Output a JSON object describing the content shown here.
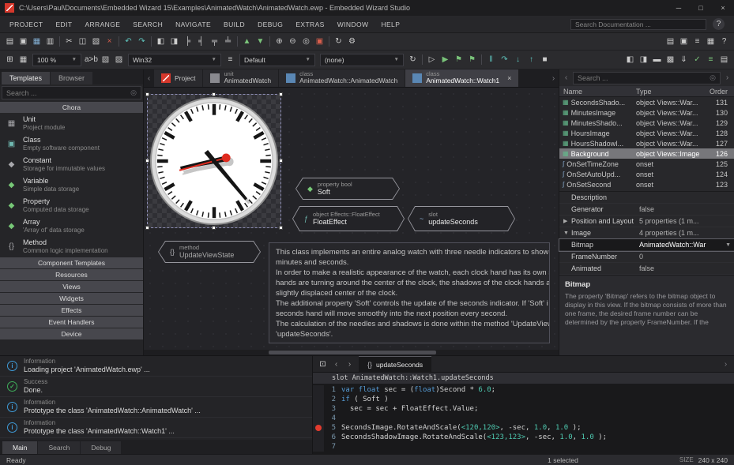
{
  "colors": {
    "accent_red": "#d6382c",
    "selection_gray": "#77777b",
    "keyword_blue": "#569cd6",
    "number_teal": "#4ec9b0",
    "breakpoint_red": "#e23b2e",
    "info_blue": "#3f9bd8",
    "success_green": "#3fae5a"
  },
  "titlebar": {
    "title": "C:\\Users\\Paul\\Documents\\Embedded Wizard 15\\Examples\\AnimatedWatch\\AnimatedWatch.ewp - Embedded Wizard Studio",
    "minimize": "─",
    "maximize": "□",
    "close": "×"
  },
  "menubar": {
    "items": [
      "PROJECT",
      "EDIT",
      "ARRANGE",
      "SEARCH",
      "NAVIGATE",
      "BUILD",
      "DEBUG",
      "EXTRAS",
      "WINDOW",
      "HELP"
    ],
    "doc_search_placeholder": "Search Documentation ...",
    "help_button": "?"
  },
  "toolbar_main": {
    "icons": [
      {
        "name": "new-project",
        "glyph": "▤",
        "color": "#cdcdcd"
      },
      {
        "name": "open-project",
        "glyph": "▣",
        "color": "#cdcdcd"
      },
      {
        "name": "save-all",
        "glyph": "▦",
        "color": "#82aed2"
      },
      {
        "name": "export",
        "glyph": "▥",
        "color": "#cdcdcd"
      },
      {
        "sep": true
      },
      {
        "name": "cut",
        "glyph": "✂",
        "color": "#cdcdcd"
      },
      {
        "name": "copy",
        "glyph": "◫",
        "color": "#cdcdcd"
      },
      {
        "name": "paste",
        "glyph": "▧",
        "color": "#cdcdcd"
      },
      {
        "name": "delete",
        "glyph": "×",
        "color": "#d95f4d"
      },
      {
        "sep": true
      },
      {
        "name": "undo",
        "glyph": "↶",
        "color": "#5fc4bd"
      },
      {
        "name": "redo",
        "glyph": "↷",
        "color": "#5fc4bd"
      },
      {
        "sep": true
      },
      {
        "name": "bring-forward",
        "glyph": "◧",
        "color": "#cdcdcd"
      },
      {
        "name": "send-backward",
        "glyph": "◨",
        "color": "#cdcdcd"
      },
      {
        "name": "align-left",
        "glyph": "╞",
        "color": "#cdcdcd"
      },
      {
        "name": "align-right",
        "glyph": "╡",
        "color": "#cdcdcd"
      },
      {
        "name": "align-top",
        "glyph": "╤",
        "color": "#cdcdcd"
      },
      {
        "name": "align-bottom",
        "glyph": "╧",
        "color": "#cdcdcd"
      },
      {
        "sep": true
      },
      {
        "name": "arrange-up",
        "glyph": "▲",
        "color": "#79c279"
      },
      {
        "name": "arrange-down",
        "glyph": "▼",
        "color": "#79c279"
      },
      {
        "sep": true
      },
      {
        "name": "zoom-in",
        "glyph": "⊕",
        "color": "#cdcdcd"
      },
      {
        "name": "zoom-out",
        "glyph": "⊖",
        "color": "#cdcdcd"
      },
      {
        "name": "zoom-selection",
        "glyph": "◎",
        "color": "#cdcdcd"
      },
      {
        "name": "highlight-unused",
        "glyph": "▣",
        "color": "#d95f4d"
      },
      {
        "sep": true
      },
      {
        "name": "update-screen",
        "glyph": "↻",
        "color": "#cdcdcd"
      },
      {
        "name": "settings-gear",
        "glyph": "⚙",
        "color": "#cdcdcd"
      }
    ],
    "icons_end": [
      {
        "name": "show-gallery",
        "glyph": "▤",
        "color": "#cdcdcd"
      },
      {
        "name": "show-inspector",
        "glyph": "▣",
        "color": "#cdcdcd"
      },
      {
        "name": "show-log",
        "glyph": "≡",
        "color": "#cdcdcd"
      },
      {
        "name": "show-browser",
        "glyph": "▦",
        "color": "#cdcdcd"
      },
      {
        "name": "show-help",
        "glyph": "?",
        "color": "#cdcdcd"
      }
    ]
  },
  "toolbar_view": {
    "icons_a": [
      {
        "name": "show-grid",
        "glyph": "⊞",
        "color": "#cdcdcd"
      },
      {
        "name": "snap-to-grid",
        "glyph": "▦",
        "color": "#cdcdcd"
      }
    ],
    "zoom_value": "100 %",
    "icons_b": [
      {
        "name": "text-compare",
        "glyph": "a>b",
        "color": "#c9c9c9"
      },
      {
        "name": "styles",
        "glyph": "▧",
        "color": "#cdcdcd"
      },
      {
        "name": "variants",
        "glyph": "▨",
        "color": "#cdcdcd"
      }
    ],
    "profile_value": "Win32",
    "icons_profile": [
      {
        "name": "profile-list",
        "glyph": "≡",
        "color": "#cdcdcd"
      }
    ],
    "config_value": "Default",
    "language_value": "(none)",
    "icons_run": [
      {
        "name": "reload",
        "glyph": "↻",
        "color": "#cdcdcd"
      },
      {
        "sep": true
      },
      {
        "name": "start-prototyper",
        "glyph": "▷",
        "color": "#cdcdcd"
      },
      {
        "name": "run",
        "glyph": "▶",
        "color": "#79c279"
      },
      {
        "name": "flag-profile-1",
        "glyph": "⚑",
        "color": "#79c279"
      },
      {
        "name": "flag-profile-2",
        "glyph": "⚑",
        "color": "#79c279"
      },
      {
        "sep": true
      },
      {
        "name": "pause",
        "glyph": "‖",
        "color": "#5fc4bd"
      },
      {
        "name": "step-over",
        "glyph": "↷",
        "color": "#5fc4bd"
      },
      {
        "name": "step-into",
        "glyph": "↓",
        "color": "#5fc4bd"
      },
      {
        "name": "step-out",
        "glyph": "↑",
        "color": "#5fc4bd"
      },
      {
        "name": "stop",
        "glyph": "■",
        "color": "#cdcdcd"
      }
    ],
    "icons_right": [
      {
        "name": "toggle-left-panel",
        "glyph": "◧",
        "color": "#cdcdcd"
      },
      {
        "name": "toggle-right-panel",
        "glyph": "◨",
        "color": "#cdcdcd"
      },
      {
        "name": "toggle-bottom-panel",
        "glyph": "▬",
        "color": "#cdcdcd"
      },
      {
        "name": "lock",
        "glyph": "▩",
        "color": "#cdcdcd"
      },
      {
        "name": "download",
        "glyph": "⇓",
        "color": "#cdcdcd"
      },
      {
        "name": "verify",
        "glyph": "✓",
        "color": "#79c279"
      },
      {
        "name": "task-list",
        "glyph": "≡",
        "color": "#79c279"
      },
      {
        "name": "more-tools",
        "glyph": "▤",
        "color": "#cdcdcd"
      }
    ]
  },
  "templates_panel": {
    "tabs": [
      "Templates",
      "Browser"
    ],
    "search_placeholder": "Search ...",
    "group": "Chora",
    "items": [
      {
        "name": "Unit",
        "desc": "Project module",
        "icon": "▦"
      },
      {
        "name": "Class",
        "desc": "Empty software component",
        "icon": "▣"
      },
      {
        "name": "Constant",
        "desc": "Storage for immutable values",
        "icon": "◆"
      },
      {
        "name": "Variable",
        "desc": "Simple data storage",
        "icon": "◆"
      },
      {
        "name": "Property",
        "desc": "Computed data storage",
        "icon": "◆"
      },
      {
        "name": "Array",
        "desc": "'Array of' data storage",
        "icon": "◆"
      },
      {
        "name": "Method",
        "desc": "Common logic implementation",
        "icon": "{}"
      }
    ],
    "collapsed_groups": [
      "Component Templates",
      "Resources",
      "Views",
      "Widgets",
      "Effects",
      "Event Handlers",
      "Device"
    ]
  },
  "editor_tabs": {
    "project_label": "Project",
    "tabs": [
      {
        "kind": "unit",
        "label": "AnimatedWatch"
      },
      {
        "kind": "class",
        "label": "AnimatedWatch::AnimatedWatch"
      },
      {
        "kind": "class",
        "label": "AnimatedWatch::Watch1"
      }
    ],
    "close": "×"
  },
  "canvas": {
    "nodes": [
      {
        "kind": "property bool",
        "label": "Soft",
        "icon": "◆"
      },
      {
        "kind": "object Effects::FloatEffect",
        "label": "FloatEffect",
        "icon": "ƒ"
      },
      {
        "kind": "slot",
        "label": "updateSeconds",
        "icon": "~"
      },
      {
        "kind": "method",
        "label": "UpdateViewState",
        "icon": "{}"
      }
    ],
    "description": [
      "This class implements an entire analog watch with three needle indicators to show",
      "minutes and seconds.",
      "In order to make a realistic appearance of the watch, each clock hand has its own s",
      "hands are turning around the center of the clock, the shadows of the clock hands a",
      "slightly displaced center of the clock.",
      "The additional property 'Soft' controls the update of the seconds indicator. If 'Soft' i",
      "seconds hand will move smoothly into the next position every second.",
      "The calculation of the needles and shadows is done within the method 'UpdateView",
      "'updateSeconds'."
    ]
  },
  "members": {
    "search_placeholder": "Search ...",
    "columns": [
      "Name",
      "Type",
      "Order"
    ],
    "rows": [
      {
        "icon": "▦",
        "name": "SecondsShado...",
        "type": "object Views::War...",
        "order": "131"
      },
      {
        "icon": "▦",
        "name": "MinutesImage",
        "type": "object Views::War...",
        "order": "130"
      },
      {
        "icon": "▦",
        "name": "MinutesShado...",
        "type": "object Views::War...",
        "order": "129"
      },
      {
        "icon": "▦",
        "name": "HoursImage",
        "type": "object Views::War...",
        "order": "128"
      },
      {
        "icon": "▦",
        "name": "HoursShadowI...",
        "type": "object Views::War...",
        "order": "127"
      },
      {
        "icon": "▦",
        "name": "Background",
        "type": "object Views::Image",
        "order": "126"
      },
      {
        "icon": "∫",
        "name": "OnSetTimeZone",
        "type": "onset",
        "order": "125"
      },
      {
        "icon": "∫",
        "name": "OnSetAutoUpd...",
        "type": "onset",
        "order": "124"
      },
      {
        "icon": "∫",
        "name": "OnSetSecond",
        "type": "onset",
        "order": "123"
      }
    ]
  },
  "inspector": {
    "rows": [
      {
        "arrow": "",
        "label": "Description",
        "value": ""
      },
      {
        "arrow": "",
        "label": "Generator",
        "value": "false"
      },
      {
        "arrow": "▶",
        "label": "Position and Layout",
        "value": "5 properties (1 m..."
      },
      {
        "arrow": "▼",
        "label": "Image",
        "value": "4 properties (1 m..."
      },
      {
        "arrow": "",
        "label": "Bitmap",
        "value": "AnimatedWatch::War"
      },
      {
        "arrow": "",
        "label": "FrameNumber",
        "value": "0"
      },
      {
        "arrow": "",
        "label": "Animated",
        "value": "false"
      }
    ],
    "combo_arrow": "▼"
  },
  "help": {
    "title": "Bitmap",
    "text": "The property 'Bitmap' refers to the bitmap object to display in this view. If the bitmap consists of more than one frame, the desired frame number can be determined by the property FrameNumber. If the"
  },
  "log": {
    "entries": [
      {
        "kind": "Information",
        "msg": "Loading project 'AnimatedWatch.ewp' ...",
        "icon": "i"
      },
      {
        "kind": "Success",
        "msg": "Done.",
        "icon": "✓"
      },
      {
        "kind": "Information",
        "msg": "Prototype the class 'AnimatedWatch::AnimatedWatch' ...",
        "icon": "i"
      },
      {
        "kind": "Information",
        "msg": "Prototype the class 'AnimatedWatch::Watch1' ...",
        "icon": "i"
      }
    ],
    "tabs": [
      "Main",
      "Search",
      "Debug"
    ]
  },
  "code": {
    "panel_icons": [
      {
        "name": "dock-editor",
        "glyph": "⊡",
        "color": "#cdcdcd"
      },
      {
        "name": "history-back",
        "glyph": "‹",
        "color": "#9a9a9a"
      },
      {
        "name": "history-forward",
        "glyph": "›",
        "color": "#9a9a9a"
      }
    ],
    "tab": "updateSeconds",
    "tab_icon": "{}",
    "header": "slot AnimatedWatch::Watch1.updateSeconds",
    "lines": [
      {
        "num": "1",
        "segments": [
          {
            "c": "kw",
            "t": "var float "
          },
          {
            "c": "pl",
            "t": "sec = ("
          },
          {
            "c": "kw",
            "t": "float"
          },
          {
            "c": "pl",
            "t": ")Second * "
          },
          {
            "c": "num",
            "t": "6.0"
          },
          {
            "c": "pl",
            "t": ";"
          }
        ]
      },
      {
        "num": "2",
        "segments": [
          {
            "c": "kw",
            "t": "if"
          },
          {
            "c": "pl",
            "t": " ( Soft )"
          }
        ]
      },
      {
        "num": "3",
        "segments": [
          {
            "c": "pl",
            "t": "  sec = sec + FloatEffect.Value;"
          }
        ]
      },
      {
        "num": "4",
        "segments": []
      },
      {
        "num": "5",
        "segments": [
          {
            "c": "pl",
            "t": "SecondsImage.RotateAndScale("
          },
          {
            "c": "num",
            "t": "<120,120>"
          },
          {
            "c": "pl",
            "t": ", -sec, "
          },
          {
            "c": "num",
            "t": "1.0"
          },
          {
            "c": "pl",
            "t": ", "
          },
          {
            "c": "num",
            "t": "1.0"
          },
          {
            "c": "pl",
            "t": " );"
          }
        ]
      },
      {
        "num": "6",
        "segments": [
          {
            "c": "pl",
            "t": "SecondsShadowImage.RotateAndScale("
          },
          {
            "c": "num",
            "t": "<123,123>"
          },
          {
            "c": "pl",
            "t": ", -sec, "
          },
          {
            "c": "num",
            "t": "1.0"
          },
          {
            "c": "pl",
            "t": ", "
          },
          {
            "c": "num",
            "t": "1.0"
          },
          {
            "c": "pl",
            "t": " );"
          }
        ]
      },
      {
        "num": "7",
        "segments": []
      }
    ]
  },
  "statusbar": {
    "ready": "Ready",
    "selection": "1 selected",
    "size_label": "SIZE",
    "size_value": "240 x 240"
  }
}
